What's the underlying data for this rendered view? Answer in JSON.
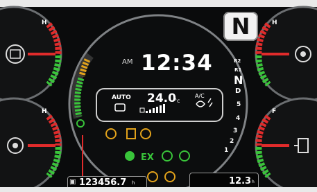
{
  "gear": {
    "current": "N"
  },
  "clock": {
    "ampm": "AM",
    "time": "12:34"
  },
  "climate": {
    "mode": "AUTO",
    "temperature": "24.0",
    "unit": "°c",
    "ac_label": "A/C",
    "fan_level": 6
  },
  "gear_positions": [
    "R2",
    "R1",
    "N",
    "D",
    "5",
    "4",
    "3",
    "2",
    "1"
  ],
  "odometer": {
    "value": "123456.7",
    "unit": "h"
  },
  "trip": {
    "value": "12.3",
    "unit": "h"
  },
  "gauges": {
    "top_left": {
      "high_label": "H"
    },
    "bottom_left": {
      "high_label": "H"
    },
    "top_right": {
      "high_label": "H"
    },
    "bottom_right": {
      "high_label": "F"
    }
  },
  "colors": {
    "green": "#39c43a",
    "red": "#e02b2b",
    "amber": "#e2a21b",
    "white": "#ffffff"
  },
  "icons": [
    "engine-oil-temp-icon",
    "coolant-temp-icon",
    "hydraulic-temp-icon",
    "fuel-icon",
    "fan-icon",
    "warning-ring-icon",
    "hazard-icon",
    "brake-icon",
    "turn-signal-icon",
    "exhaust-icon",
    "hydraulic-oil-icon",
    "power-icon",
    "parking-brake-icon",
    "service-icon"
  ]
}
